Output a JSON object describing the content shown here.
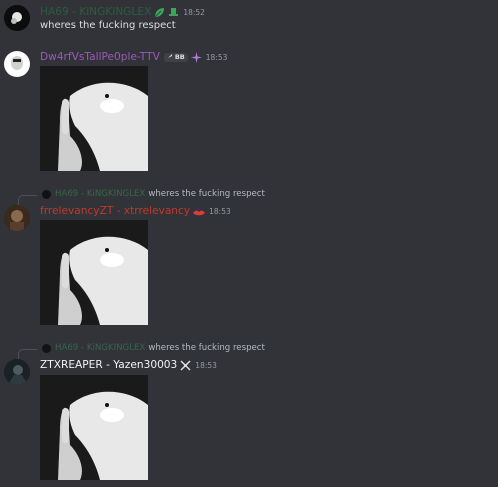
{
  "colors": {
    "background": "#313338",
    "name_dim_green": "#2d7d46",
    "name_purple": "#9b59b6",
    "name_red": "#c0392b",
    "name_white": "#f2f3f5",
    "timestamp": "#949ba4"
  },
  "messages": [
    {
      "author": "HA69 - KiNGKINGLEX",
      "badges": [
        "leaf-icon",
        "hat-icon"
      ],
      "time": "18:52",
      "text": "wheres the fucking respect"
    },
    {
      "author": "Dw4rfVsTallPe0ple-TTV",
      "badge_label": "BB",
      "badge_icon": "wrench-icon",
      "role_icon": "sparkle-icon",
      "time": "18:53",
      "image_alt": "dog-shush-image"
    },
    {
      "reply": {
        "author": "HA69 - KiNGKINGLEX",
        "text": "wheres the fucking respect"
      },
      "author": "frrelevancyZT - xtrrelevancy",
      "role_icon": "lips-icon",
      "time": "18:53",
      "image_alt": "dog-shush-image"
    },
    {
      "reply": {
        "author": "HA69 - KiNGKINGLEX",
        "text": "wheres the fucking respect"
      },
      "author": "ZTXREAPER - Yazen30003",
      "role_icon": "crossed-swords-icon",
      "time": "18:53",
      "image_alt": "dog-shush-image"
    }
  ]
}
